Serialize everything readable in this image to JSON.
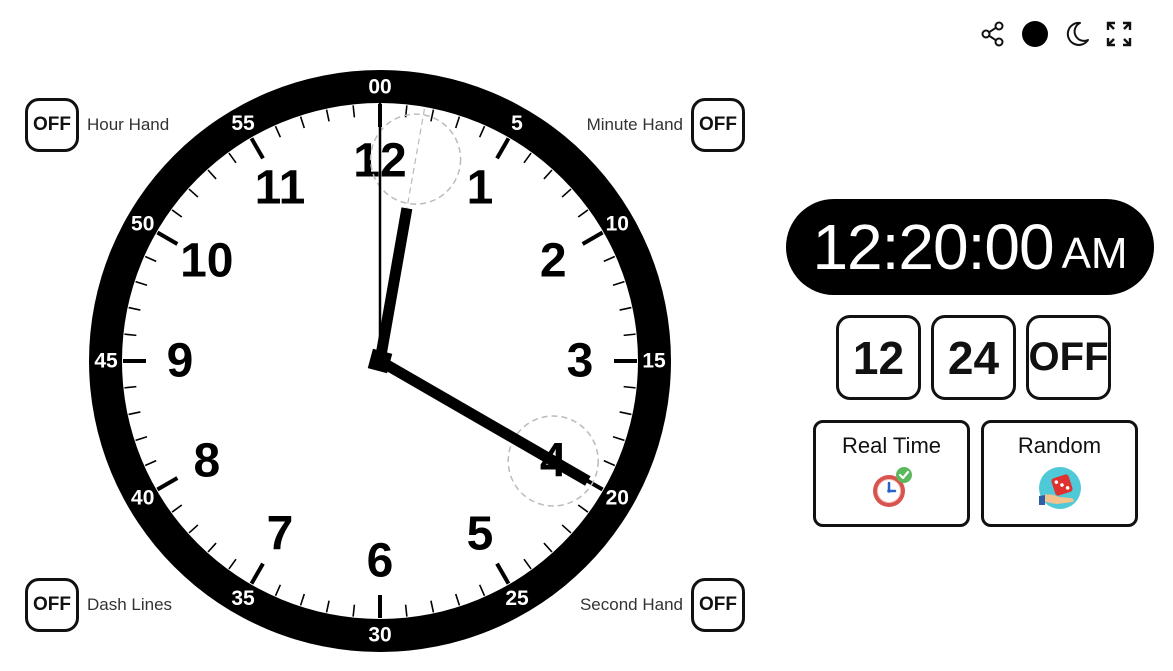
{
  "toolbar": {
    "icons": [
      "share-icon",
      "theme-dot-icon",
      "dark-mode-moon-icon",
      "fullscreen-icon"
    ]
  },
  "toggles": {
    "hour_hand": {
      "state": "OFF",
      "label": "Hour Hand"
    },
    "minute_hand": {
      "state": "OFF",
      "label": "Minute Hand"
    },
    "dash_lines": {
      "state": "OFF",
      "label": "Dash Lines"
    },
    "second_hand": {
      "state": "OFF",
      "label": "Second Hand"
    }
  },
  "clock": {
    "hour_numbers": [
      "12",
      "1",
      "2",
      "3",
      "4",
      "5",
      "6",
      "7",
      "8",
      "9",
      "10",
      "11"
    ],
    "minute_labels": [
      "00",
      "5",
      "10",
      "15",
      "20",
      "25",
      "30",
      "35",
      "40",
      "45",
      "50",
      "55"
    ],
    "hours": 12,
    "minutes": 20,
    "seconds": 0,
    "colors": {
      "ring": "#000000",
      "face": "#ffffff",
      "hands": "#000000",
      "highlight": "#bbbbbb"
    }
  },
  "digital": {
    "time": "12:20:00",
    "ampm": "AM"
  },
  "format_buttons": [
    "12",
    "24",
    "OFF"
  ],
  "modes": {
    "real_time": {
      "label": "Real Time",
      "icon": "clock-check-icon"
    },
    "random": {
      "label": "Random",
      "icon": "dice-hand-icon"
    }
  }
}
